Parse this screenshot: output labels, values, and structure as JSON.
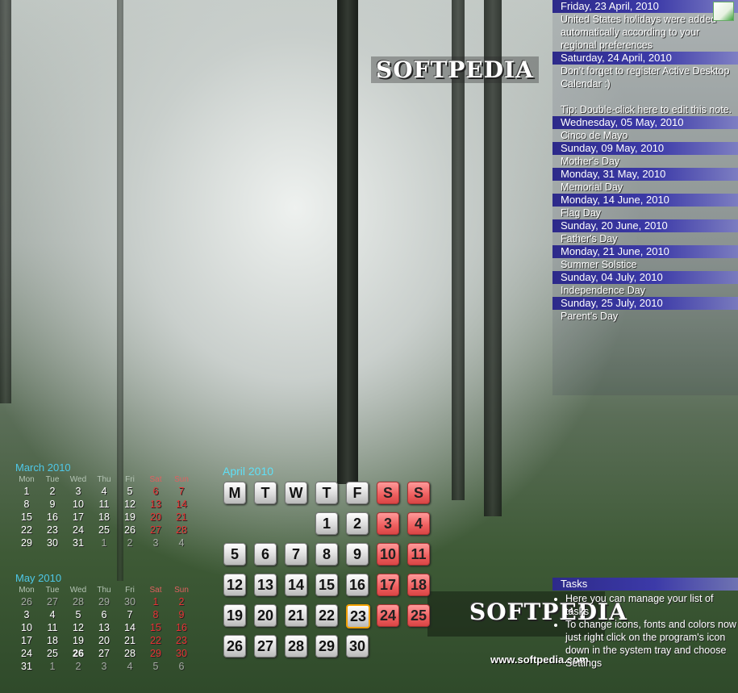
{
  "branding": {
    "logo_top": "SOFTPEDIA",
    "logo_bottom": "SOFTPEDIA",
    "url": "www.softpedia.com"
  },
  "events": [
    {
      "date": "Friday, 23 April, 2010",
      "lines": [
        "United States holidays were added automatically according to your regional preferences"
      ]
    },
    {
      "date": "Saturday, 24 April, 2010",
      "lines": [
        "Don't forget to register Active Desktop Calendar :)",
        "",
        "Tip: Double-click here to edit this note."
      ]
    },
    {
      "date": "Wednesday, 05 May, 2010",
      "lines": [
        "Cinco de Mayo"
      ]
    },
    {
      "date": "Sunday, 09 May, 2010",
      "lines": [
        "Mother's Day"
      ]
    },
    {
      "date": "Monday, 31 May, 2010",
      "lines": [
        "Memorial Day"
      ]
    },
    {
      "date": "Monday, 14 June, 2010",
      "lines": [
        "Flag Day"
      ]
    },
    {
      "date": "Sunday, 20 June, 2010",
      "lines": [
        "Father's Day"
      ]
    },
    {
      "date": "Monday, 21 June, 2010",
      "lines": [
        "Summer Solstice"
      ]
    },
    {
      "date": "Sunday, 04 July, 2010",
      "lines": [
        "Independence Day"
      ]
    },
    {
      "date": "Sunday, 25 July, 2010",
      "lines": [
        "Parent's Day"
      ]
    }
  ],
  "mini_march": {
    "title": "March 2010",
    "dow": [
      "Mon",
      "Tue",
      "Wed",
      "Thu",
      "Fri",
      "Sat",
      "Sun"
    ],
    "days": [
      "1",
      "2",
      "3",
      "4",
      "5",
      "6",
      "7",
      "8",
      "9",
      "10",
      "11",
      "12",
      "13",
      "14",
      "15",
      "16",
      "17",
      "18",
      "19",
      "20",
      "21",
      "22",
      "23",
      "24",
      "25",
      "26",
      "27",
      "28",
      "29",
      "30",
      "31",
      "1",
      "2",
      "3",
      "4"
    ]
  },
  "mini_may": {
    "title": "May 2010",
    "dow": [
      "Mon",
      "Tue",
      "Wed",
      "Thu",
      "Fri",
      "Sat",
      "Sun"
    ],
    "days": [
      "26",
      "27",
      "28",
      "29",
      "30",
      "1",
      "2",
      "3",
      "4",
      "5",
      "6",
      "7",
      "8",
      "9",
      "10",
      "11",
      "12",
      "13",
      "14",
      "15",
      "16",
      "17",
      "18",
      "19",
      "20",
      "21",
      "22",
      "23",
      "24",
      "25",
      "26",
      "27",
      "28",
      "29",
      "30",
      "31",
      "1",
      "2",
      "3",
      "4",
      "5",
      "6"
    ]
  },
  "main_calendar": {
    "title": "April 2010",
    "dow": [
      "M",
      "T",
      "W",
      "T",
      "F",
      "S",
      "S"
    ],
    "days": [
      "",
      "",
      "",
      "1",
      "2",
      "3",
      "4",
      "5",
      "6",
      "7",
      "8",
      "9",
      "10",
      "11",
      "12",
      "13",
      "14",
      "15",
      "16",
      "17",
      "18",
      "19",
      "20",
      "21",
      "22",
      "23",
      "24",
      "25",
      "26",
      "27",
      "28",
      "29",
      "30"
    ]
  },
  "tasks": {
    "header": "Tasks",
    "items": [
      "Here you can manage your list of tasks",
      "To change icons, fonts and colors now just right click on the program's icon down in the system tray and choose Settings"
    ]
  },
  "colors": {
    "header_bar": "#3c3aa8",
    "weekend_red": "#e73434",
    "title_cyan": "#5fe0f6"
  },
  "icons": {
    "notes": "notes-icon"
  }
}
